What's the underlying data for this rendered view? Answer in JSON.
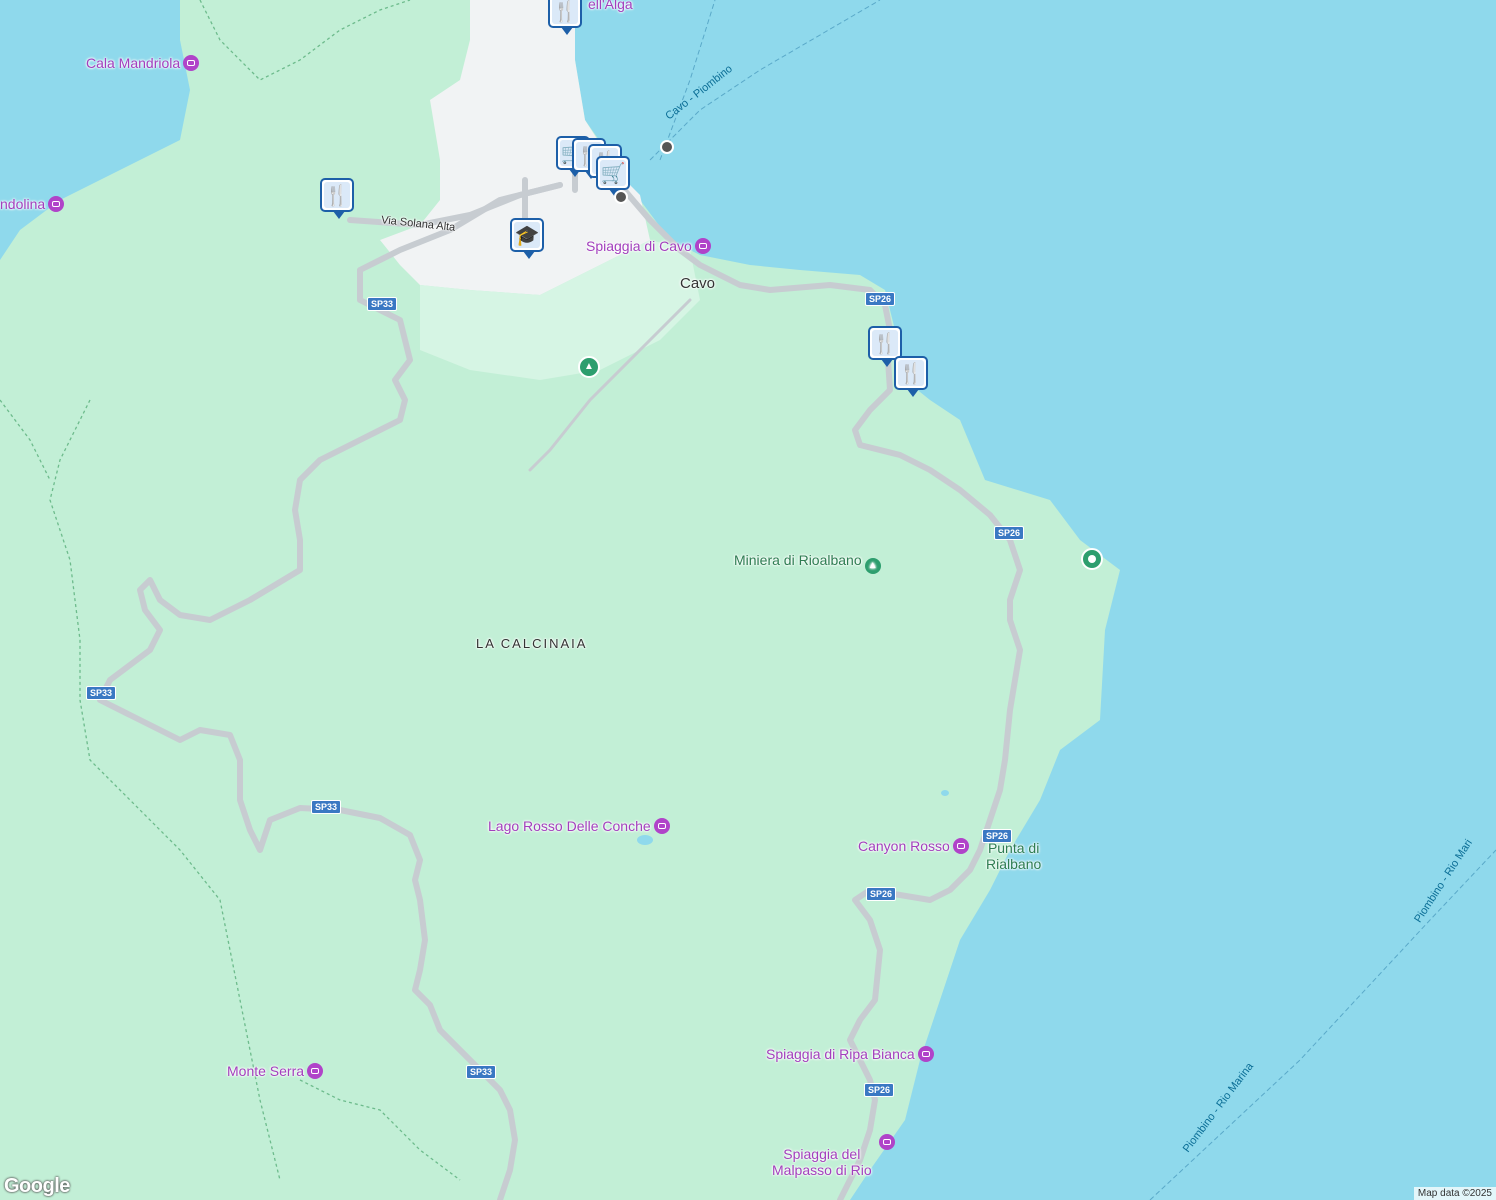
{
  "map": {
    "attribution": "Map data ©2025",
    "logo": "Google",
    "places": {
      "cavo": "Cavo",
      "la_calcinaia": "LA CALCINAIA",
      "punta_di_rialbano": "Punta di\nRialbano"
    },
    "pois": {
      "cala_mandriola": "Cala Mandriola",
      "mandolina": "ndolina",
      "spiaggia_di_cavo": "Spiaggia di Cavo",
      "miniera_di_rioalbano": "Miniera di Rioalbano",
      "lago_rosso": "Lago Rosso Delle Conche",
      "canyon_rosso": "Canyon Rosso",
      "spiaggia_ripa_bianca": "Spiaggia di Ripa Bianca",
      "monte_serra": "Monte Serra",
      "spiaggia_malpasso": "Spiaggia del\nMalpasso di Rio",
      "top_partial": "ell'Alga"
    },
    "streets": {
      "via_solana_alta": "Via Solana Alta"
    },
    "ferries": {
      "cavo_piombino": "Cavo - Piombino",
      "piombino_rio_marina_1": "Piombino - Rio Marina",
      "piombino_rio_marina_2": "Piombino - Rio Mari"
    },
    "route_shields": {
      "sp33_a": "SP33",
      "sp33_b": "SP33",
      "sp33_c": "SP33",
      "sp33_d": "SP33",
      "sp26_a": "SP26",
      "sp26_b": "SP26",
      "sp26_c": "SP26",
      "sp26_d": "SP26",
      "sp26_e": "SP26"
    },
    "colors": {
      "water": "#8fd9ec",
      "land": "#c2efd6",
      "urban": "#f1f3f4",
      "road": "#c7ccd1",
      "poi_purple": "#a33fbd",
      "pin_blue": "#1d5fa8"
    }
  }
}
